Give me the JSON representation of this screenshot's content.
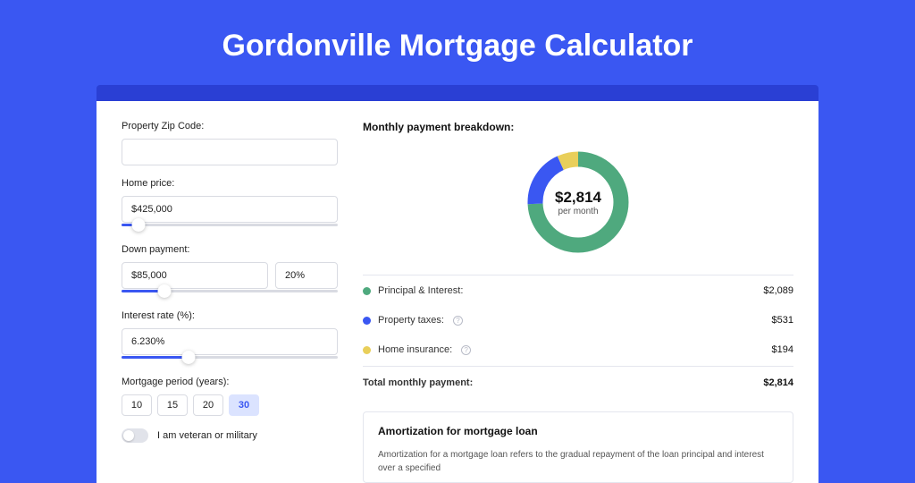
{
  "page": {
    "title": "Gordonville Mortgage Calculator"
  },
  "form": {
    "zip": {
      "label": "Property Zip Code:",
      "value": ""
    },
    "home_price": {
      "label": "Home price:",
      "value": "$425,000",
      "slider_pct": 8
    },
    "down_payment": {
      "label": "Down payment:",
      "value": "$85,000",
      "pct": "20%",
      "slider_pct": 20
    },
    "interest": {
      "label": "Interest rate (%):",
      "value": "6.230%",
      "slider_pct": 31
    },
    "period": {
      "label": "Mortgage period (years):",
      "options": [
        "10",
        "15",
        "20",
        "30"
      ],
      "selected": "30"
    },
    "veteran": {
      "label": "I am veteran or military",
      "checked": false
    }
  },
  "breakdown": {
    "title": "Monthly payment breakdown:",
    "donut": {
      "total": "$2,814",
      "per": "per month"
    },
    "items": [
      {
        "label": "Principal & Interest:",
        "value": "$2,089",
        "color": "green",
        "info": false
      },
      {
        "label": "Property taxes:",
        "value": "$531",
        "color": "blue",
        "info": true
      },
      {
        "label": "Home insurance:",
        "value": "$194",
        "color": "yellow",
        "info": true
      }
    ],
    "total_row": {
      "label": "Total monthly payment:",
      "value": "$2,814"
    }
  },
  "amort": {
    "title": "Amortization for mortgage loan",
    "text": "Amortization for a mortgage loan refers to the gradual repayment of the loan principal and interest over a specified"
  },
  "chart_data": {
    "type": "pie",
    "title": "Monthly payment breakdown",
    "series": [
      {
        "name": "Principal & Interest",
        "value": 2089,
        "color": "#4fa97e"
      },
      {
        "name": "Property taxes",
        "value": 531,
        "color": "#3a57f2"
      },
      {
        "name": "Home insurance",
        "value": 194,
        "color": "#e9cf5a"
      }
    ],
    "total": 2814
  }
}
